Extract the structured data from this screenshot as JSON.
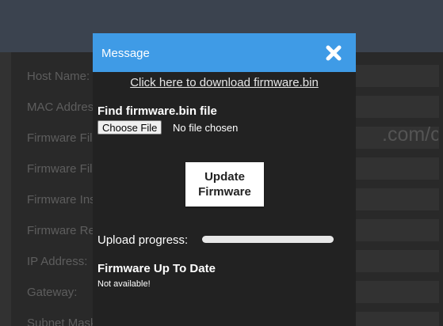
{
  "background": {
    "rows": [
      {
        "label": "Host Name:",
        "field": ""
      },
      {
        "label": "MAC Address:",
        "field": ""
      },
      {
        "label": "Firmware File URL:",
        "field": ".com/c"
      },
      {
        "label": "Firmware File Name:",
        "field": ""
      },
      {
        "label": "Firmware Installed:",
        "field": ""
      },
      {
        "label": "Firmware Remote:",
        "field": ""
      },
      {
        "label": "IP Address:",
        "field": ""
      },
      {
        "label": "Gateway:",
        "field": ""
      },
      {
        "label": "Subnet Mask:",
        "field": ""
      }
    ]
  },
  "modal": {
    "title": "Message",
    "close_icon": "close-x-icon",
    "download_link": "Click here to download firmware.bin",
    "find_label": "Find firmware.bin file",
    "choose_button": "Choose File",
    "no_file_text": "No file chosen",
    "update_button": "Update Firmware",
    "progress_label": "Upload progress:",
    "progress_value": 0,
    "status_title": "Firmware Up To Date",
    "status_text": "Not available!"
  },
  "colors": {
    "header": "#3f9be6",
    "modal_bg": "#222222"
  }
}
